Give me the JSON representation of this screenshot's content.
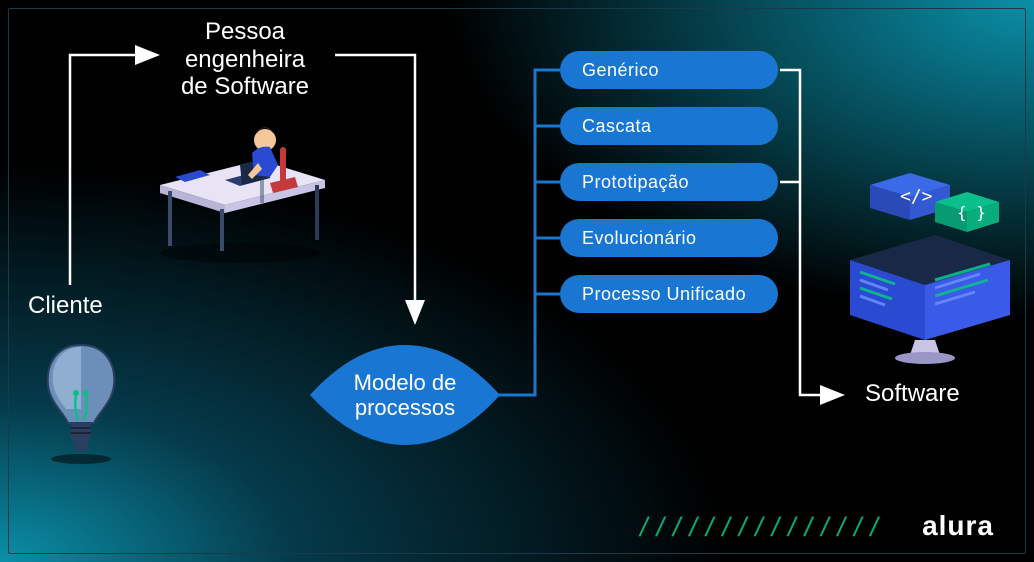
{
  "cliente": {
    "label": "Cliente"
  },
  "engenheira": {
    "line1": "Pessoa",
    "line2": "engenheira",
    "line3": "de Software"
  },
  "modelo": {
    "line1": "Modelo de",
    "line2": "processos"
  },
  "models": [
    {
      "label": "Genérico"
    },
    {
      "label": "Cascata"
    },
    {
      "label": "Prototipação"
    },
    {
      "label": "Evolucionário"
    },
    {
      "label": "Processo Unificado"
    }
  ],
  "software": {
    "label": "Software"
  },
  "brand": {
    "slashes": "///////////////",
    "logo": "alura"
  }
}
